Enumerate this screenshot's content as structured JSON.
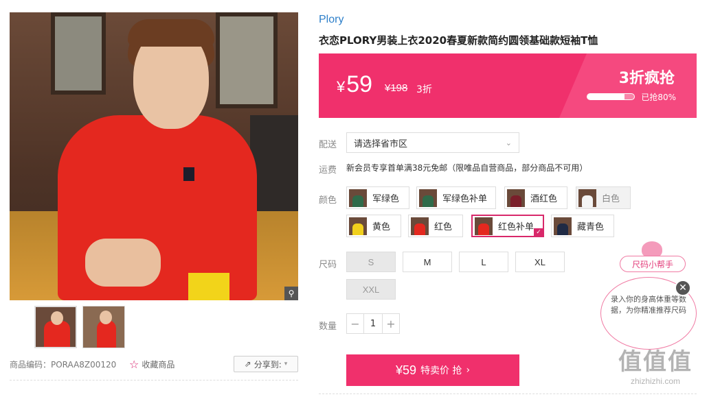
{
  "gallery": {
    "zoom_icon": "magnifier-icon",
    "thumbnails": [
      {
        "label": "thumb-1"
      },
      {
        "label": "thumb-2"
      }
    ]
  },
  "meta": {
    "product_code": "商品编码：PORAA8Z00120",
    "favorite_label": "收藏商品",
    "share_label": "分享到:"
  },
  "product": {
    "brand": "Plory",
    "title": "衣恋PLORY男装上衣2020春夏新款简约圆领基础款短袖T恤"
  },
  "price": {
    "currency": "¥",
    "current": "59",
    "original": "¥198",
    "discount": "3折",
    "promo_title": "3折疯抢",
    "sold_fraction": 0.8,
    "sold_text": "已抢80%"
  },
  "delivery": {
    "label": "配送",
    "placeholder": "请选择省市区"
  },
  "shipping": {
    "label": "运费",
    "text": "新会员专享首单满38元免邮（限唯品自营商品，部分商品不可用）"
  },
  "colors": {
    "label": "颜色",
    "options": [
      {
        "name": "军绿色",
        "swatch": "#2f6b4a",
        "state": "normal"
      },
      {
        "name": "军绿色补单",
        "swatch": "#2f6b4a",
        "state": "normal"
      },
      {
        "name": "酒红色",
        "swatch": "#7a1e2a",
        "state": "normal"
      },
      {
        "name": "白色",
        "swatch": "#f4f4f4",
        "state": "disabled"
      },
      {
        "name": "黄色",
        "swatch": "#f0cf1c",
        "state": "normal"
      },
      {
        "name": "红色",
        "swatch": "#e4281f",
        "state": "normal"
      },
      {
        "name": "红色补单",
        "swatch": "#e4281f",
        "state": "selected"
      },
      {
        "name": "藏青色",
        "swatch": "#1f2a44",
        "state": "normal"
      }
    ]
  },
  "sizes": {
    "label": "尺码",
    "options": [
      {
        "name": "S",
        "state": "disabled"
      },
      {
        "name": "M",
        "state": "normal"
      },
      {
        "name": "L",
        "state": "normal"
      },
      {
        "name": "XL",
        "state": "normal"
      },
      {
        "name": "XXL",
        "state": "disabled"
      }
    ]
  },
  "quantity": {
    "label": "数量",
    "value": "1",
    "minus": "−",
    "plus": "+"
  },
  "buy": {
    "price": "¥59",
    "text": "特卖价 抢",
    "chevron": "›"
  },
  "helper": {
    "tag": "尺码小帮手",
    "bubble": "录入你的身高体重等数据，为你精准推荐尺码",
    "close": "✕"
  },
  "watermark": {
    "logo": "值值值",
    "url": "zhizhizhi.com"
  },
  "colors_theme": {
    "accent": "#f0306c",
    "brand_link": "#2d7fc9"
  }
}
